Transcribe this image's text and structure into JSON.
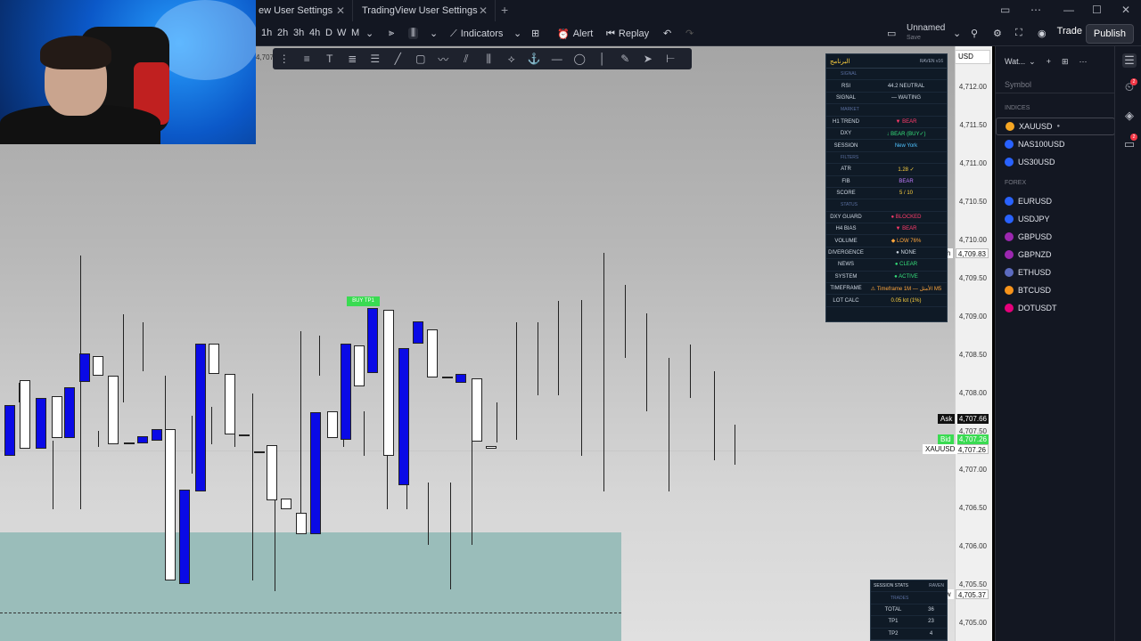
{
  "tabs": [
    {
      "title": "ew User Settings"
    },
    {
      "title": "TradingView User Settings"
    }
  ],
  "toolbar": {
    "intervals": [
      "1h",
      "2h",
      "3h",
      "4h",
      "D",
      "W",
      "M"
    ],
    "indicators_label": "Indicators",
    "alert_label": "Alert",
    "replay_label": "Replay",
    "layout_name": "Unnamed",
    "layout_status": "Save",
    "trade_label": "Trade",
    "publish_label": "Publish",
    "currency": "USD"
  },
  "chart": {
    "buy_label": "BUY TP1",
    "corner_price": "4,707."
  },
  "price_axis": {
    "ticks": [
      "4,712.00",
      "4,711.50",
      "4,711.00",
      "4,710.50",
      "4,710.00",
      "4,709.50",
      "4,709.00",
      "4,708.50",
      "4,708.00",
      "4,707.50",
      "4,707.00",
      "4,706.50",
      "4,706.00",
      "4,705.50",
      "4,705.00"
    ],
    "high": {
      "label": "High",
      "value": "4,709.83"
    },
    "ask": {
      "label": "Ask",
      "value": "4,707.66"
    },
    "bid": {
      "label": "Bid",
      "value": "4,707.26"
    },
    "symbol": {
      "label": "XAUUSD",
      "value": "4,707.26"
    },
    "low": {
      "label": "Low",
      "value": "4,705.37"
    }
  },
  "raven": {
    "title": "البرنامج",
    "brand": "RAVEN  v16",
    "rows": [
      {
        "section": "SIGNAL"
      },
      {
        "k": "RSI",
        "v": "44.2  NEUTRAL",
        "c": "#cfd8e3"
      },
      {
        "k": "SIGNAL",
        "v": "— WAITING",
        "c": "#cfd8e3"
      },
      {
        "section": "MARKET"
      },
      {
        "k": "H1 TREND",
        "v": "▼ BEAR",
        "c": "#ff3b6b"
      },
      {
        "k": "DXY",
        "v": "↓ BEAR (BUY✓)",
        "c": "#35e07a"
      },
      {
        "k": "SESSION",
        "v": "New York",
        "c": "#4fc3ff"
      },
      {
        "section": "FILTERS"
      },
      {
        "k": "ATR",
        "v": "1.28 ✓",
        "c": "#ffd23f"
      },
      {
        "k": "FIB",
        "v": "BEAR",
        "c": "#c17bff"
      },
      {
        "k": "SCORE",
        "v": "5 / 10",
        "c": "#ffd23f"
      },
      {
        "section": "STATUS"
      },
      {
        "k": "DXY GUARD",
        "v": "● BLOCKED",
        "c": "#ff3b6b"
      },
      {
        "k": "H4 BIAS",
        "v": "▼ BEAR",
        "c": "#ff3b6b"
      },
      {
        "k": "VOLUME",
        "v": "◆ LOW 76%",
        "c": "#ffa53b"
      },
      {
        "k": "DIVERGENCE",
        "v": "● NONE",
        "c": "#cfd8e3"
      },
      {
        "k": "NEWS",
        "v": "● CLEAR",
        "c": "#35e07a"
      },
      {
        "k": "SYSTEM",
        "v": "● ACTIVE",
        "c": "#35e07a"
      },
      {
        "k": "TIMEFRAME",
        "v": "⚠ Timeframe 1M — الأمثل M5",
        "c": "#ffa53b"
      },
      {
        "k": "LOT CALC",
        "v": "0.05 lot  (1%)",
        "c": "#ffd23f"
      }
    ]
  },
  "stats": {
    "title": "SESSION STATS",
    "brand": "RAVEN",
    "rows": [
      {
        "section": "TRADES"
      },
      {
        "k": "TOTAL",
        "v": "36"
      },
      {
        "k": "TP1",
        "v": "23"
      },
      {
        "k": "TP2",
        "v": "4"
      }
    ]
  },
  "watchlist": {
    "title": "Wat...",
    "column": "Symbol",
    "sections": [
      {
        "name": "INDICES",
        "items": [
          {
            "symbol": "XAUUSD",
            "color": "#f5a623",
            "suffix": "●"
          },
          {
            "symbol": "NAS100USD",
            "color": "#2962ff",
            "suffix": ""
          },
          {
            "symbol": "US30USD",
            "color": "#2962ff",
            "suffix": ""
          }
        ]
      },
      {
        "name": "FOREX",
        "items": [
          {
            "symbol": "EURUSD",
            "color": "#2962ff",
            "suffix": ""
          },
          {
            "symbol": "USDJPY",
            "color": "#2962ff",
            "suffix": ""
          },
          {
            "symbol": "GBPUSD",
            "color": "#9c27b0",
            "suffix": ""
          },
          {
            "symbol": "GBPNZD",
            "color": "#9c27b0",
            "suffix": ""
          },
          {
            "symbol": "ETHUSD",
            "color": "#5c6bc0",
            "suffix": ""
          },
          {
            "symbol": "BTCUSD",
            "color": "#f7931a",
            "suffix": ""
          },
          {
            "symbol": "DOTUSDT",
            "color": "#e6007a",
            "suffix": ""
          }
        ]
      }
    ]
  },
  "badges": [
    "2",
    "2"
  ],
  "colors": {
    "bear_candle": "#0a0ae6",
    "bull_candle": "#ffffff",
    "zone": "#9abdba",
    "bid": "#3adb52"
  }
}
